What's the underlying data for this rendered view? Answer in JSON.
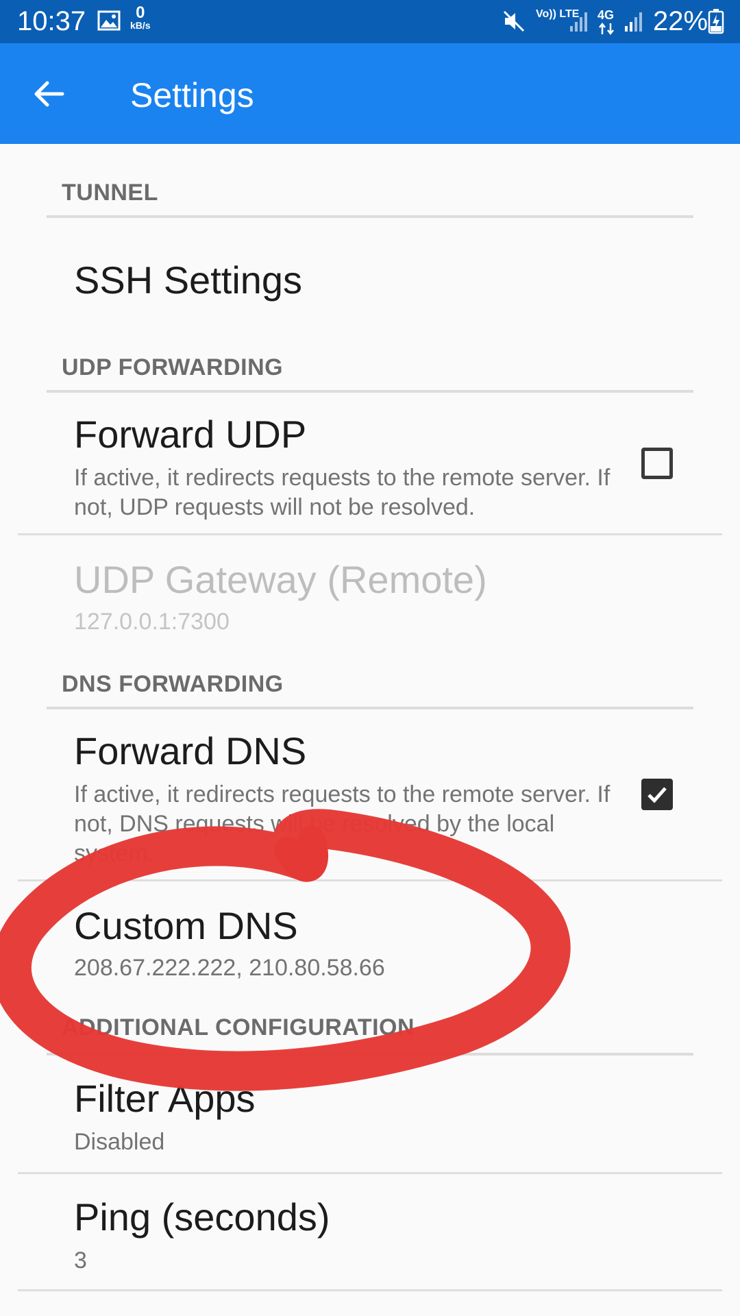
{
  "status_bar": {
    "time": "10:37",
    "net_speed_value": "0",
    "net_speed_unit": "kB/s",
    "network_label_1": "Vo)) LTE",
    "network_label_2": "4G",
    "battery": "22%",
    "icons": [
      "image-icon",
      "mute-icon",
      "signal-icon",
      "data-arrows-icon",
      "signal-icon",
      "battery-charging-icon"
    ]
  },
  "app_bar": {
    "title": "Settings",
    "back_icon": "arrow-back-icon"
  },
  "sections": {
    "tunnel": {
      "header": "TUNNEL",
      "ssh_settings": {
        "title": "SSH Settings"
      }
    },
    "udp": {
      "header": "UDP FORWARDING",
      "forward_udp": {
        "title": "Forward UDP",
        "summary": "If active, it redirects requests to the remote server. If not, UDP requests will not be resolved.",
        "checked": false
      },
      "udp_gateway": {
        "title": "UDP Gateway (Remote)",
        "summary": "127.0.0.1:7300",
        "enabled": false
      }
    },
    "dns": {
      "header": "DNS FORWARDING",
      "forward_dns": {
        "title": "Forward DNS",
        "summary": "If active, it redirects requests to the remote server. If not, DNS requests will be resolved by the local system.",
        "checked": true
      },
      "custom_dns": {
        "title": "Custom DNS",
        "summary": "208.67.222.222, 210.80.58.66"
      }
    },
    "additional": {
      "header": "ADDITIONAL CONFIGURATION",
      "filter_apps": {
        "title": "Filter Apps",
        "summary": "Disabled"
      },
      "ping": {
        "title": "Ping (seconds)",
        "summary": "3"
      }
    }
  },
  "colors": {
    "status_bar": "#0a5fb4",
    "app_bar": "#1a83f0",
    "annotation_circle": "#e53935"
  }
}
